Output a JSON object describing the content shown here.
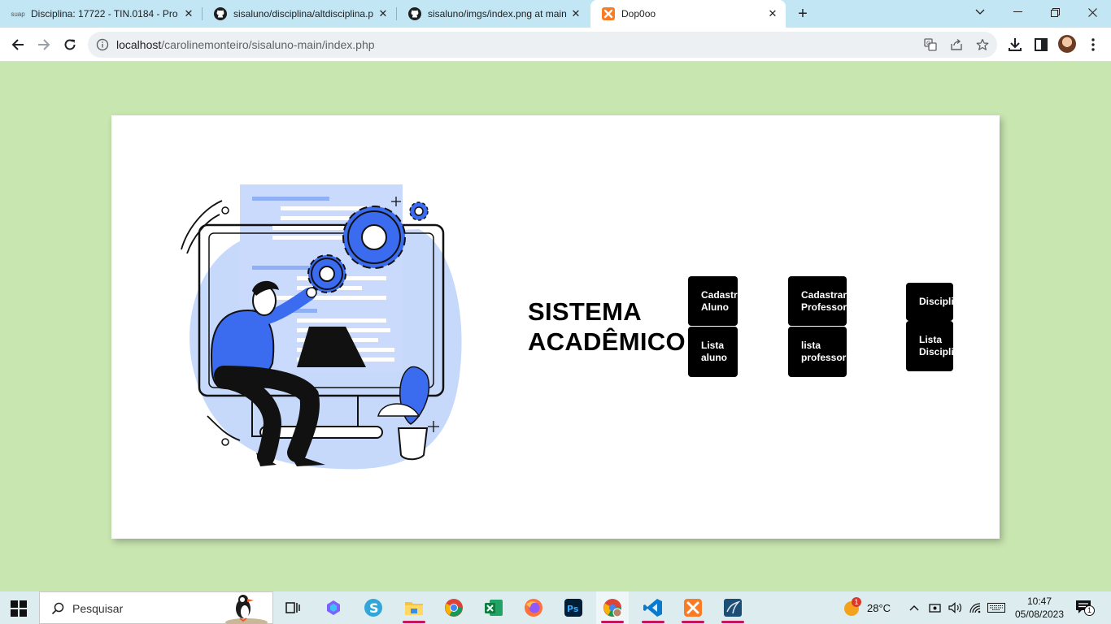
{
  "browser": {
    "tabs": [
      {
        "title": "Disciplina: 17722 - TIN.0184 - Pro",
        "favicon_text": "suap",
        "icon": "suap-icon",
        "active": false
      },
      {
        "title": "sisaluno/disciplina/altdisciplina.p",
        "icon": "github-icon",
        "active": false
      },
      {
        "title": "sisaluno/imgs/index.png at main",
        "icon": "github-icon",
        "active": false
      },
      {
        "title": "Dop0oo",
        "icon": "xampp-icon",
        "active": true
      }
    ],
    "url_host": "localhost",
    "url_path": "/carolinemonteiro/sisaluno-main/index.php",
    "colors": {
      "tabstrip": "#c3e6f5",
      "page_background": "#c8e6b0"
    }
  },
  "page": {
    "heading_line1": "SISTEMA",
    "heading_line2": "ACADÊMICO",
    "menu": {
      "cadastro_aluno": "Cadastro\nAluno",
      "lista_aluno": "Lista\naluno",
      "cadastro_professor": "Cadastrar\nProfessor",
      "lista_professor": "lista\nprofessor",
      "disciplina": "Disciplina",
      "lista_disciplina": "Lista\nDisciplina"
    }
  },
  "taskbar": {
    "search_placeholder": "Pesquisar",
    "weather_temp": "28°C",
    "weather_badge": "1",
    "time": "10:47",
    "date": "05/08/2023",
    "notification_count": "1"
  }
}
